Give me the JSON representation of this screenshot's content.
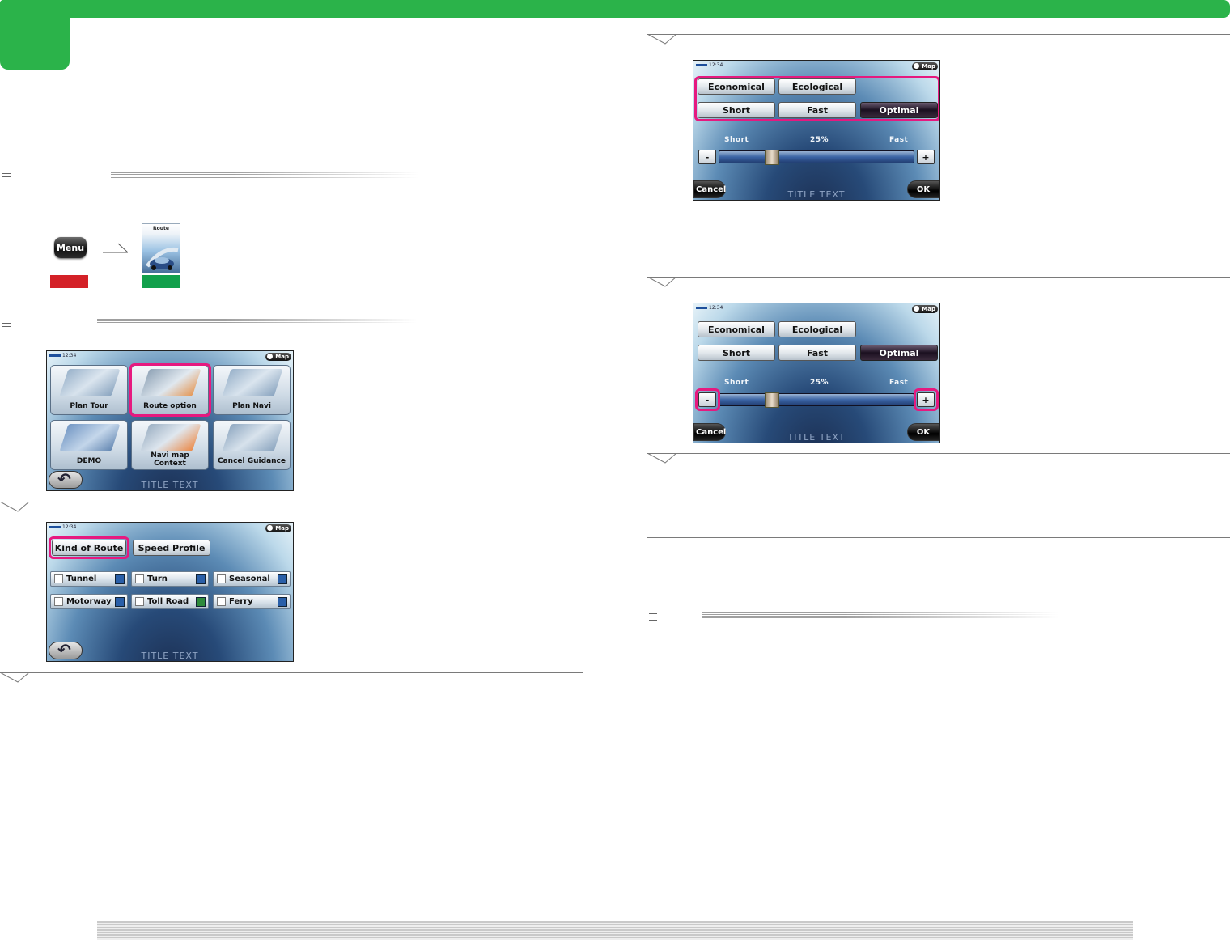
{
  "icons": {
    "menu_step_arrow": "right-arrow-icon",
    "section_mark": "triple-line-icon"
  },
  "colors": {
    "accent_green": "#2bb34a",
    "highlight_pink": "#e6197f",
    "red_label": "#d42127",
    "green_label": "#12a04b"
  },
  "menu_button": {
    "label": "Menu"
  },
  "route_tile": {
    "label": "Route"
  },
  "screen_nav": {
    "time": "12:34",
    "map_label": "Map",
    "title_text": "TITLE TEXT",
    "tiles": [
      {
        "label": "Plan Tour"
      },
      {
        "label": "Route option"
      },
      {
        "label": "Plan Navi"
      },
      {
        "label": "DEMO"
      },
      {
        "label": "Navi map\nContext"
      },
      {
        "label": "Cancel Guidance"
      }
    ]
  },
  "screen_route": {
    "time": "12:34",
    "map_label": "Map",
    "title_text": "TITLE TEXT",
    "tabs": [
      {
        "label": "Kind of Route"
      },
      {
        "label": "Speed Profile"
      }
    ],
    "options": [
      {
        "label": "Tunnel"
      },
      {
        "label": "Turn"
      },
      {
        "label": "Seasonal"
      },
      {
        "label": "Motorway"
      },
      {
        "label": "Toll Road"
      },
      {
        "label": "Ferry"
      }
    ]
  },
  "screen_speed_a": {
    "time": "12:34",
    "map_label": "Map",
    "title_text": "TITLE TEXT",
    "buttons": {
      "economical": "Economical",
      "ecological": "Ecological",
      "short": "Short",
      "fast": "Fast",
      "optimal": "Optimal"
    },
    "slider": {
      "left_label": "Short",
      "value_label": "25%",
      "right_label": "Fast",
      "value": 0.25,
      "minus": "-",
      "plus": "+"
    },
    "cancel": "Cancel",
    "ok": "OK"
  },
  "screen_speed_b": {
    "time": "12:34",
    "map_label": "Map",
    "title_text": "TITLE TEXT",
    "buttons": {
      "economical": "Economical",
      "ecological": "Ecological",
      "short": "Short",
      "fast": "Fast",
      "optimal": "Optimal"
    },
    "slider": {
      "left_label": "Short",
      "value_label": "25%",
      "right_label": "Fast",
      "value": 0.25,
      "minus": "-",
      "plus": "+"
    },
    "cancel": "Cancel",
    "ok": "OK"
  }
}
